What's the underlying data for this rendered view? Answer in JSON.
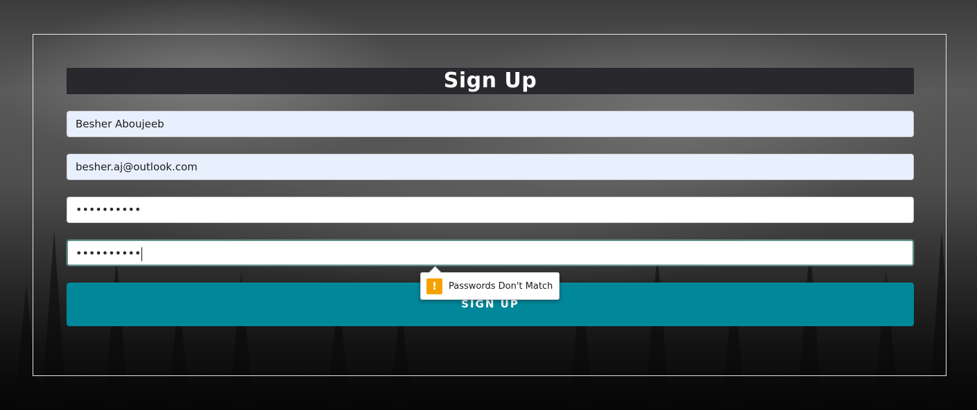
{
  "form": {
    "title": "Sign Up",
    "name_value": "Besher Aboujeeb",
    "email_value": "besher.aj@outlook.com",
    "password_mask": "••••••••••",
    "confirm_mask": "••••••••••",
    "submit_label": "SIGN UP"
  },
  "validation": {
    "message": "Passwords Don't Match",
    "icon": "warning-icon",
    "icon_glyph": "!"
  },
  "colors": {
    "submit": "#008799",
    "autofill": "#e8f0fe",
    "warning": "#f5a200",
    "title_bar": "#26262a"
  }
}
